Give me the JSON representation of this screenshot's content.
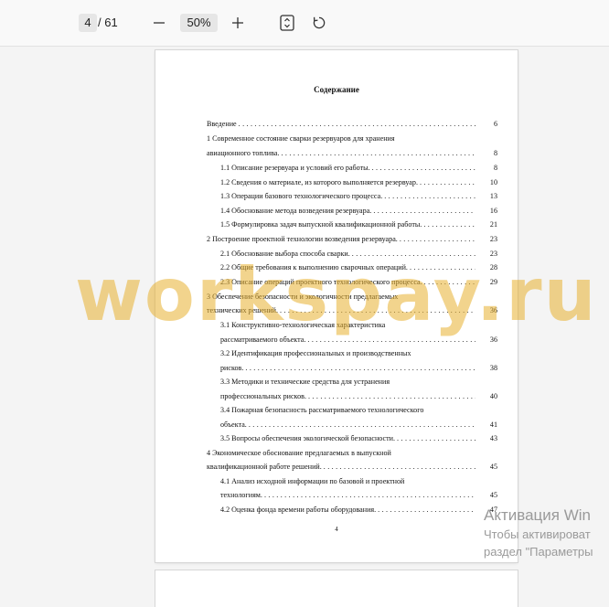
{
  "toolbar": {
    "page_current": "4",
    "page_total": "/ 61",
    "zoom_level": "50%",
    "zoom_out_icon": "minus-icon",
    "zoom_in_icon": "plus-icon",
    "fit_icon": "fit-page-icon",
    "rotate_icon": "rotate-icon"
  },
  "document": {
    "toc_title": "Содержание",
    "page_number": "4",
    "entries": [
      {
        "text": "Введение",
        "page": "6"
      },
      {
        "text": "1 Современное состояние сварки резервуаров для хранения"
      },
      {
        "text": "авиационного топлива.",
        "page": "8"
      },
      {
        "text": "1.1 Описание резервуара и условий его работы.",
        "page": "8"
      },
      {
        "text": "1.2 Сведения о материале, из которого выполняется резервуар.",
        "page": "10"
      },
      {
        "text": "1.3 Операции базового технологического процесса.",
        "page": "13"
      },
      {
        "text": "1.4 Обоснование метода возведения резервуара.",
        "page": "16"
      },
      {
        "text": "1.5 Формулировка задач выпускной квалификационной работы.",
        "page": "21"
      },
      {
        "text": "2 Построение проектной технологии возведения резервуара.",
        "page": "23"
      },
      {
        "text": "2.1 Обоснование выбора способа сварки.",
        "page": "23"
      },
      {
        "text": "2.2 Общие требования к выполнению сварочных операций.",
        "page": "28"
      },
      {
        "text": "2.3 Описание операций проектного технологического процесса.",
        "page": "29"
      },
      {
        "text": "3 Обеспечение безопасности и экологичности предлагаемых"
      },
      {
        "text": "технических решений.",
        "page": "36"
      },
      {
        "text": "3.1 Конструктивно-технологическая характеристика"
      },
      {
        "text": "рассматриваемого объекта.",
        "page": "36"
      },
      {
        "text": "3.2 Идентификация профессиональных и производственных"
      },
      {
        "text": "рисков.",
        "page": "38"
      },
      {
        "text": "3.3 Методики и технические средства для устранения"
      },
      {
        "text": "профессиональных рисков.",
        "page": "40"
      },
      {
        "text": "3.4 Пожарная безопасность рассматриваемого технологического"
      },
      {
        "text": "объекта.",
        "page": "41"
      },
      {
        "text": "3.5 Вопросы обеспечения экологической безопасности.",
        "page": "43"
      },
      {
        "text": "4 Экономическое обоснование предлагаемых в выпускной"
      },
      {
        "text": "квалификационной работе решений.",
        "page": "45"
      },
      {
        "text": "4.1 Анализ исходной информации по базовой и проектной"
      },
      {
        "text": "технологиям.",
        "page": "45"
      },
      {
        "text": "4.2 Оценка фонда времени работы оборудования.",
        "page": "47"
      }
    ]
  },
  "overlay": {
    "watermark": "workspay.ru",
    "activation_title": "Активация Win",
    "activation_line1": "Чтобы активироват",
    "activation_line2": "раздел \"Параметры"
  }
}
